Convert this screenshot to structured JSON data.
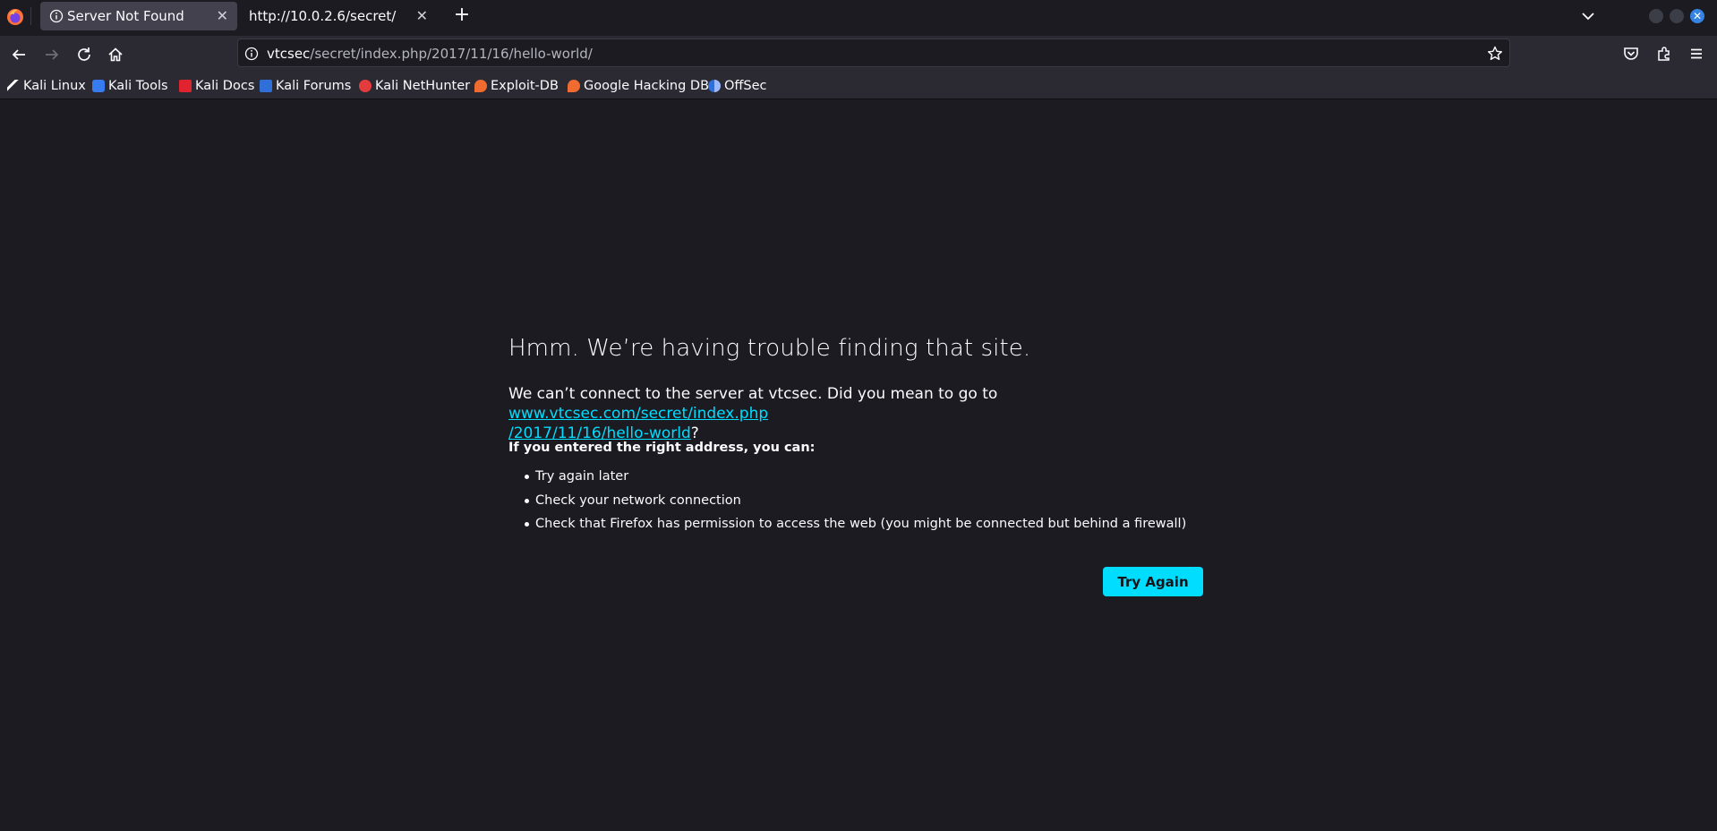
{
  "tabs": [
    {
      "title": "Server Not Found",
      "active": true
    },
    {
      "title": "http://10.0.2.6/secret/",
      "active": false
    }
  ],
  "urlbar": {
    "host": "vtcsec",
    "path": "/secret/index.php/2017/11/16/hello-world/"
  },
  "bookmarks": [
    {
      "label": "Kali Linux",
      "icon": "kali-dragon-icon"
    },
    {
      "label": "Kali Tools",
      "icon": "kali-tools-icon"
    },
    {
      "label": "Kali Docs",
      "icon": "kali-docs-icon"
    },
    {
      "label": "Kali Forums",
      "icon": "kali-forums-icon"
    },
    {
      "label": "Kali NetHunter",
      "icon": "kali-nethunter-icon"
    },
    {
      "label": "Exploit-DB",
      "icon": "exploit-db-icon"
    },
    {
      "label": "Google Hacking DB",
      "icon": "ghdb-icon"
    },
    {
      "label": "OffSec",
      "icon": "offsec-icon"
    }
  ],
  "error": {
    "title": "Hmm. We’re having trouble finding that site.",
    "desc_prefix": "We can’t connect to the server at vtcsec. Did you mean to go to ",
    "suggest_line1": "www.vtcsec.com/secret/index.php",
    "suggest_line2": "/2017/11/16/hello-world",
    "desc_suffix": "?",
    "subtitle": "If you entered the right address, you can:",
    "items": [
      "Try again later",
      "Check your network connection",
      "Check that Firefox has permission to access the web (you might be connected but behind a firewall)"
    ],
    "button": "Try Again"
  },
  "colors": {
    "accent": "#00ddff",
    "page_bg": "#1c1b22",
    "toolbar_bg": "#2b2a33"
  }
}
